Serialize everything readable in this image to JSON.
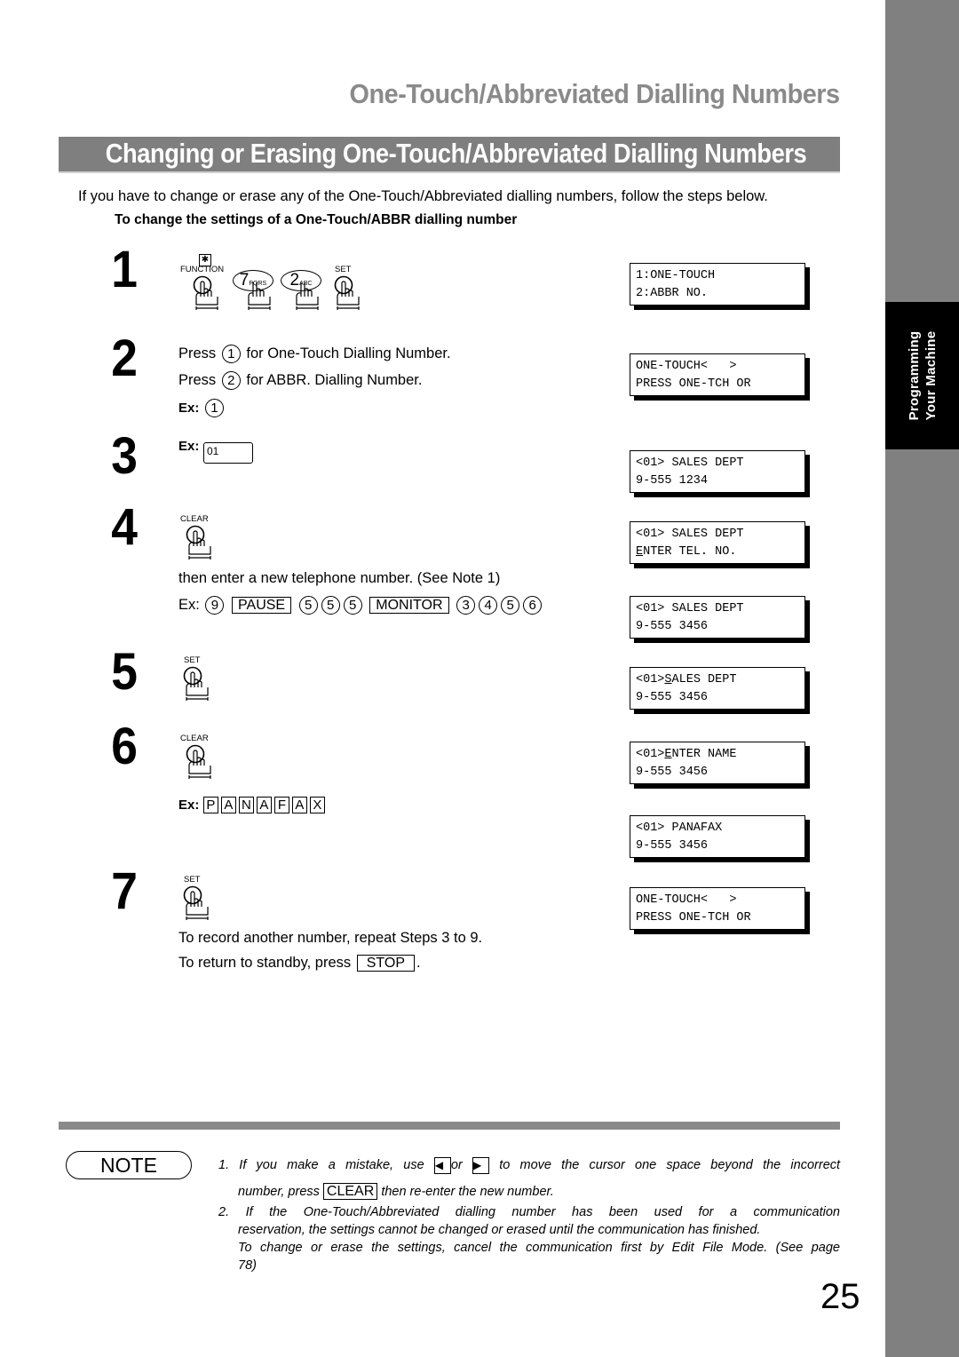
{
  "side_tab": {
    "line1": "Programming",
    "line2": "Your Machine"
  },
  "section_title": "One-Touch/Abbreviated Dialling Numbers",
  "banner_title": "Changing or Erasing One-Touch/Abbreviated Dialling Numbers",
  "intro": "If you have to change or erase any of the One-Touch/Abbreviated dialling numbers, follow the steps below.",
  "subheading": "To change the settings of a One-Touch/ABBR dialling number",
  "steps": [
    {
      "number": "1",
      "keys": [
        "FUNCTION",
        "7PQRS",
        "2ABC",
        "SET"
      ],
      "key_function_symbol": "✱",
      "key7_digit": "7",
      "key7_letters": "PQRS",
      "key2_digit": "2",
      "key2_letters": "ABC"
    },
    {
      "number": "2",
      "line1_pre": "Press",
      "line1_key": "1",
      "line1_post": "for One-Touch Dialling Number.",
      "line2_pre": "Press",
      "line2_key": "2",
      "line2_post": "for ABBR. Dialling Number.",
      "ex_label": "Ex:",
      "ex_key": "1"
    },
    {
      "number": "3",
      "ex_label": "Ex:",
      "ex_value": "01"
    },
    {
      "number": "4",
      "key": "CLEAR",
      "text": "then enter a new telephone number. (See Note 1)",
      "ex_label": "Ex:",
      "ex_sequence": [
        "9",
        "PAUSE",
        "5",
        "5",
        "5",
        "MONITOR",
        "3",
        "4",
        "5",
        "6"
      ]
    },
    {
      "number": "5",
      "key": "SET"
    },
    {
      "number": "6",
      "key": "CLEAR",
      "ex_label": "Ex:",
      "ex_letters": [
        "P",
        "A",
        "N",
        "A",
        "F",
        "A",
        "X"
      ]
    },
    {
      "number": "7",
      "key": "SET",
      "text1": "To record another number, repeat Steps 3 to 9.",
      "text2_pre": "To return to standby, press",
      "text2_key": "STOP",
      "text2_post": "."
    }
  ],
  "displays": [
    {
      "line1": "1:ONE-TOUCH",
      "line2": "2:ABBR NO."
    },
    {
      "line1": "ONE-TOUCH<   >",
      "line2": "PRESS ONE-TCH OR"
    },
    {
      "line1": "<01> SALES DEPT",
      "line2": "9-555 1234"
    },
    {
      "line1": "<01> SALES DEPT",
      "line2_cursor": "E",
      "line2_rest": "NTER TEL. NO."
    },
    {
      "line1": "<01> SALES DEPT",
      "line2": "9-555 3456"
    },
    {
      "line1_pre": "<01>",
      "line1_cursor": "S",
      "line1_rest": "ALES DEPT",
      "line2": "9-555 3456"
    },
    {
      "line1_pre": "<01>",
      "line1_cursor": "E",
      "line1_rest": "NTER NAME",
      "line2": "9-555 3456"
    },
    {
      "line1": "<01> PANAFAX",
      "line2": "9-555 3456"
    },
    {
      "line1": "ONE-TOUCH<   >",
      "line2": "PRESS ONE-TCH OR"
    }
  ],
  "note": {
    "badge": "NOTE",
    "item1_a": "1. If you make a mistake, use",
    "item1_left_arrow": "◀",
    "item1_or": "or",
    "item1_right_arrow": "▶",
    "item1_b": "to move the cursor one space beyond the incorrect",
    "item1_c_pre": "number, press",
    "item1_c_key": "CLEAR",
    "item1_c_post": "then re-enter the new number.",
    "item2_line1": "2. If   the One-Touch/Abbreviated dialling number has been used for a communication",
    "item2_line2": "reservation, the settings cannot be changed or erased until the communication has finished.",
    "item2_line3": "To change or erase the settings, cancel the communication first by Edit File Mode.  (See page",
    "item2_line4": "78)"
  },
  "page_number": "25"
}
